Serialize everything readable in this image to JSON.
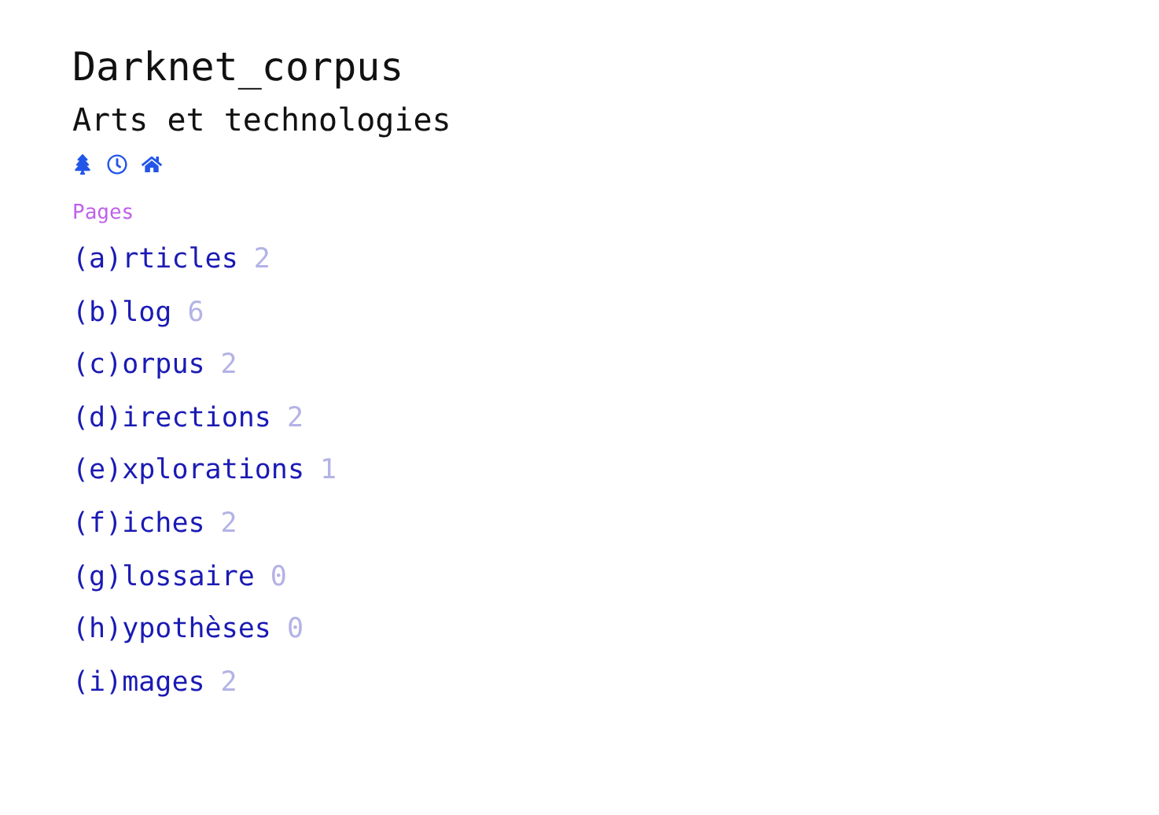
{
  "header": {
    "title": "Darknet_corpus",
    "subtitle": "Arts et technologies"
  },
  "nav_icons": [
    {
      "kind": "tree"
    },
    {
      "kind": "clock"
    },
    {
      "kind": "home"
    }
  ],
  "pages": {
    "heading": "Pages",
    "items": [
      {
        "label": "(a)rticles",
        "count": "2"
      },
      {
        "label": "(b)log",
        "count": "6"
      },
      {
        "label": "(c)orpus",
        "count": "2"
      },
      {
        "label": "(d)irections",
        "count": "2"
      },
      {
        "label": "(e)xplorations",
        "count": "1"
      },
      {
        "label": "(f)iches",
        "count": "2"
      },
      {
        "label": "(g)lossaire",
        "count": "0"
      },
      {
        "label": "(h)ypothèses",
        "count": "0"
      },
      {
        "label": "(i)mages",
        "count": "2"
      }
    ]
  }
}
